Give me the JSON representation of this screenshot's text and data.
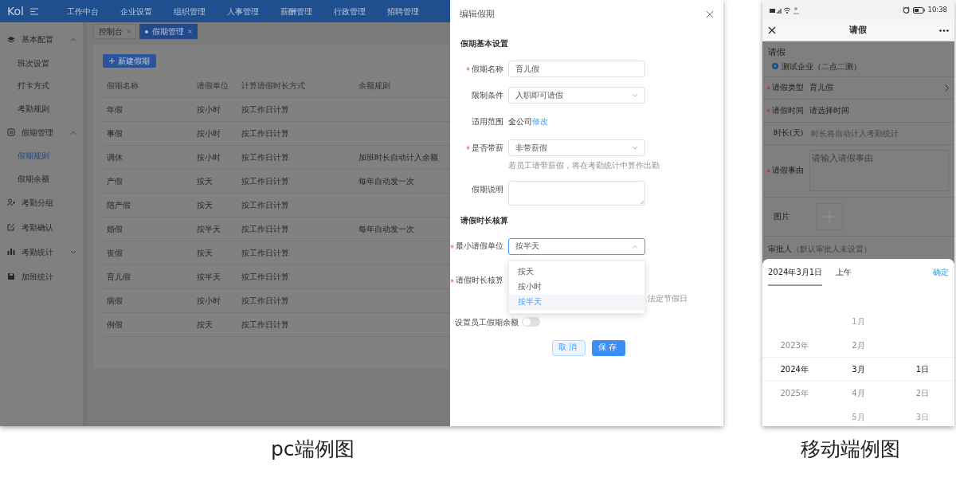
{
  "pc_screenshot": {
    "top_nav": {
      "logo": "Kol",
      "items": [
        "工作中台",
        "企业设置",
        "组织管理",
        "人事管理",
        "薪酬管理",
        "行政管理",
        "招聘管理"
      ]
    },
    "sidebar": {
      "items": [
        {
          "label": "基本配置",
          "kind": "group",
          "expanded": true,
          "children": [
            {
              "label": "班次设置",
              "selected": false
            },
            {
              "label": "打卡方式",
              "selected": false
            },
            {
              "label": "考勤规则",
              "selected": false
            }
          ]
        },
        {
          "label": "假期管理",
          "kind": "group",
          "expanded": true,
          "children": [
            {
              "label": "假期规则",
              "selected": true
            },
            {
              "label": "假期余额",
              "selected": false
            }
          ]
        },
        {
          "label": "考勤分组",
          "kind": "link"
        },
        {
          "label": "考勤确认",
          "kind": "link"
        },
        {
          "label": "考勤统计",
          "kind": "group",
          "expanded": false
        },
        {
          "label": "加班统计",
          "kind": "link"
        }
      ]
    },
    "tabs": [
      {
        "label": "控制台",
        "selected": false
      },
      {
        "label": "假期管理",
        "selected": true
      }
    ],
    "add_button": "新建假期",
    "table": {
      "columns": [
        "假期名称",
        "请假单位",
        "计算请假时长方式",
        "余额规则"
      ],
      "rows": [
        [
          "年假",
          "按小时",
          "按工作日计算",
          ""
        ],
        [
          "事假",
          "按小时",
          "按工作日计算",
          ""
        ],
        [
          "调休",
          "按小时",
          "按工作日计算",
          "加班时长自动计入余额"
        ],
        [
          "产假",
          "按天",
          "按工作日计算",
          "每年自动发一次"
        ],
        [
          "陪产假",
          "按天",
          "按工作日计算",
          ""
        ],
        [
          "婚假",
          "按半天",
          "按工作日计算",
          "每年自动发一次"
        ],
        [
          "丧假",
          "按天",
          "按工作日计算",
          ""
        ],
        [
          "育儿假",
          "按半天",
          "按工作日计算",
          ""
        ],
        [
          "病假",
          "按小时",
          "按工作日计算",
          ""
        ],
        [
          "例假",
          "按天",
          "按工作日计算",
          ""
        ]
      ]
    },
    "dialog": {
      "title": "编辑假期",
      "sections": [
        {
          "title": "假期基本设置",
          "fields": [
            {
              "label": "假期名称",
              "required": true,
              "kind": "input",
              "value": "育儿假"
            },
            {
              "label": "限制条件",
              "required": false,
              "kind": "select",
              "value": "入职即可请假",
              "open": false
            },
            {
              "label": "适用范围",
              "required": false,
              "kind": "scope",
              "value": "全公司",
              "link": "修改"
            },
            {
              "label": "是否带薪",
              "required": true,
              "kind": "select",
              "value": "非带薪假",
              "open": false,
              "hint": "若员工请带薪假，将在考勤统计中算作出勤"
            },
            {
              "label": "假期说明",
              "required": false,
              "kind": "textarea"
            }
          ]
        },
        {
          "title": "请假时长核算",
          "fields": [
            {
              "label": "最小请假单位",
              "required": true,
              "kind": "select",
              "value": "按半天",
              "open": true,
              "options": [
                {
                  "label": "按天",
                  "selected": false
                },
                {
                  "label": "按小时",
                  "selected": false
                },
                {
                  "label": "按半天",
                  "selected": true
                }
              ]
            },
            {
              "label": "请假时长核算",
              "required": true,
              "kind": "covered",
              "hint": "法定节假日"
            }
          ]
        }
      ],
      "balance_toggle": {
        "label": "设置员工假期余额",
        "on": false
      },
      "buttons": [
        {
          "label": "取消",
          "kind": "secondary"
        },
        {
          "label": "保存",
          "kind": "primary"
        }
      ]
    }
  },
  "mobile_screenshot": {
    "status_bar": {
      "time": "10:38"
    },
    "header": {
      "title": "请假"
    },
    "form": {
      "title": "请假",
      "company": "测试企业（二点二测）",
      "rows": [
        {
          "label": "请假类型",
          "required": true,
          "kind": "select",
          "value": "育儿假"
        },
        {
          "label": "请假时间",
          "required": true,
          "kind": "value",
          "value": "请选择时间"
        },
        {
          "label": "时长(天)",
          "required": false,
          "kind": "hint",
          "placeholder": "时长将自动计入考勤统计"
        },
        {
          "label": "请假事由",
          "required": true,
          "kind": "textarea",
          "placeholder": "请输入请假事由"
        },
        {
          "label": "图片",
          "required": false,
          "kind": "image"
        }
      ],
      "approver": {
        "label": "审批人",
        "note": "（默认审批人未设置）"
      }
    },
    "picker": {
      "tabs": [
        {
          "label": "2024年3月1日",
          "selected": true
        },
        {
          "label": "上午",
          "selected": false
        }
      ],
      "confirm": "确定",
      "columns": [
        [
          {
            "label": "2023年",
            "selected": false
          },
          {
            "label": "2024年",
            "selected": true
          },
          {
            "label": "2025年",
            "selected": false
          }
        ],
        [
          {
            "label": "1月",
            "selected": false
          },
          {
            "label": "2月",
            "selected": false
          },
          {
            "label": "3月",
            "selected": true
          },
          {
            "label": "4月",
            "selected": false
          },
          {
            "label": "5月",
            "selected": false
          }
        ],
        [
          {
            "label": "1日",
            "selected": true
          },
          {
            "label": "2日",
            "selected": false
          },
          {
            "label": "3日",
            "selected": false
          }
        ]
      ]
    }
  },
  "captions": [
    "pc端例图",
    "移动端例图"
  ]
}
